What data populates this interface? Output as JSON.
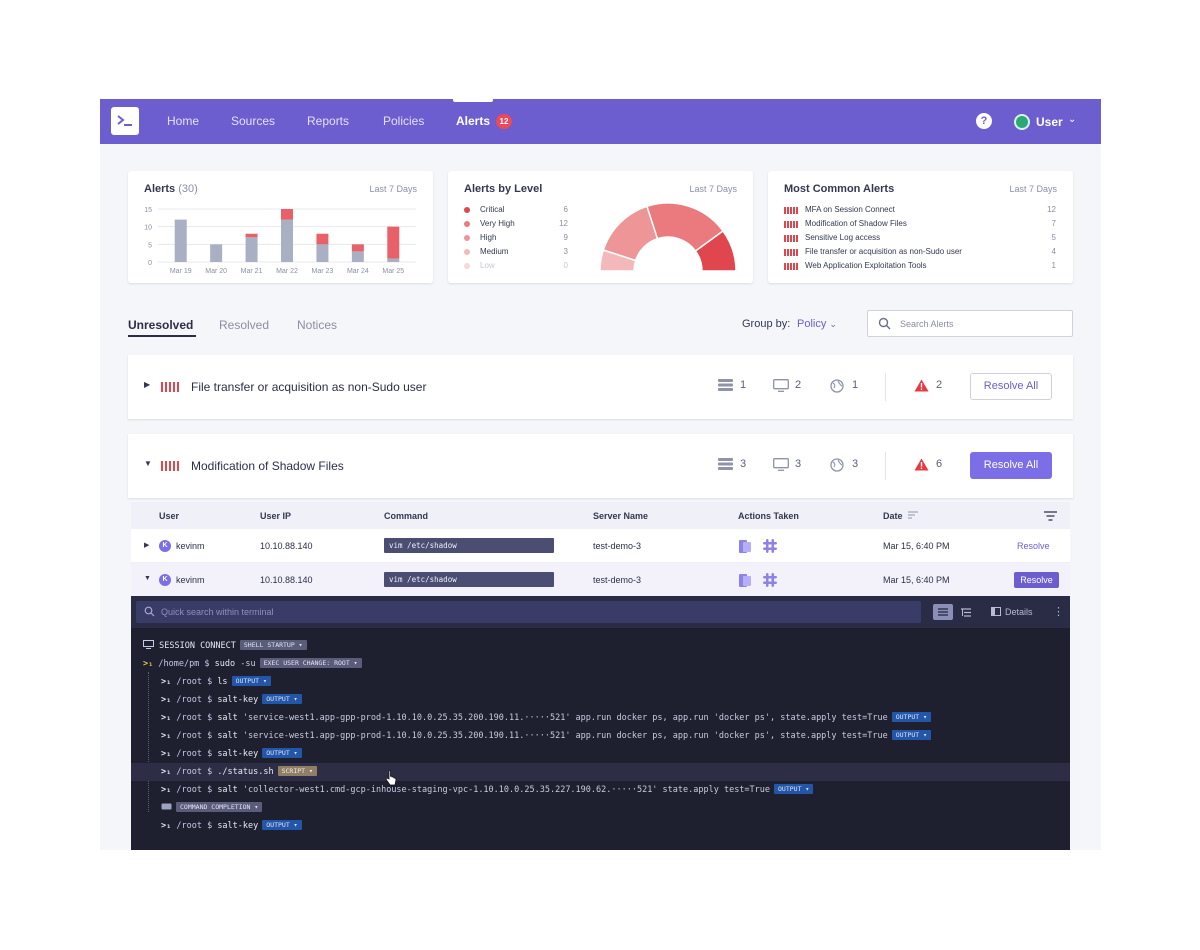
{
  "nav": {
    "items": [
      "Home",
      "Sources",
      "Reports",
      "Policies",
      "Alerts"
    ],
    "alerts_badge": "12",
    "help": "?",
    "user": "User"
  },
  "cards": {
    "alerts": {
      "title": "Alerts",
      "count": "(30)",
      "period": "Last 7 Days"
    },
    "by_level": {
      "title": "Alerts by Level",
      "period": "Last 7 Days",
      "levels": [
        {
          "name": "Critical",
          "value": "6",
          "color": "#e0464e"
        },
        {
          "name": "Very High",
          "value": "12",
          "color": "#ea7a7e"
        },
        {
          "name": "High",
          "value": "9",
          "color": "#ee9598"
        },
        {
          "name": "Medium",
          "value": "3",
          "color": "#f3b8ba"
        },
        {
          "name": "Low",
          "value": "0",
          "color": "#f6d9da"
        }
      ]
    },
    "common": {
      "title": "Most Common Alerts",
      "period": "Last 7 Days",
      "items": [
        {
          "name": "MFA on Session Connect",
          "count": "12"
        },
        {
          "name": "Modification of Shadow Files",
          "count": "7"
        },
        {
          "name": "Sensitive Log access",
          "count": "5"
        },
        {
          "name": "File transfer or acquisition as non-Sudo user",
          "count": "4"
        },
        {
          "name": "Web Application Exploitation Tools",
          "count": "1"
        }
      ]
    }
  },
  "chart_data": [
    {
      "type": "bar",
      "title": "Alerts (30)",
      "categories": [
        "Mar 19",
        "Mar 20",
        "Mar 21",
        "Mar 22",
        "Mar 23",
        "Mar 24",
        "Mar 25"
      ],
      "series": [
        {
          "name": "",
          "color": "#a9b0c3",
          "values": [
            12,
            5,
            7,
            12,
            5,
            3,
            1
          ]
        },
        {
          "name": "",
          "color": "#e86068",
          "values": [
            0,
            0,
            1,
            3,
            3,
            2,
            9
          ]
        }
      ],
      "yticks": [
        0,
        5,
        10,
        15
      ],
      "ylim": [
        0,
        15
      ],
      "stacked": true
    },
    {
      "type": "pie",
      "title": "Alerts by Level",
      "style": "half-donut",
      "labels": [
        "Critical",
        "Very High",
        "High",
        "Medium",
        "Low"
      ],
      "values": [
        6,
        12,
        9,
        3,
        0
      ]
    }
  ],
  "tabs": [
    "Unresolved",
    "Resolved",
    "Notices"
  ],
  "group_by": {
    "label": "Group by:",
    "value": "Policy"
  },
  "search": {
    "placeholder": "Search Alerts"
  },
  "policies": [
    {
      "name": "File transfer or acquisition as non-Sudo user",
      "sources": "1",
      "servers": "2",
      "ips": "1",
      "alerts": "2",
      "action": "Resolve All",
      "expanded": false
    },
    {
      "name": "Modification of Shadow Files",
      "sources": "3",
      "servers": "3",
      "ips": "3",
      "alerts": "6",
      "action": "Resolve All",
      "expanded": true
    }
  ],
  "table": {
    "headers": [
      "User",
      "User IP",
      "Command",
      "Server Name",
      "Actions Taken",
      "Date"
    ],
    "rows": [
      {
        "avatar": "K",
        "user": "kevinm",
        "ip": "10.10.88.140",
        "command": "vim /etc/shadow",
        "server": "test-demo-3",
        "date": "Mar 15, 6:40 PM",
        "action": "Resolve"
      },
      {
        "avatar": "K",
        "user": "kevinm",
        "ip": "10.10.88.140",
        "command": "vim /etc/shadow",
        "server": "test-demo-3",
        "date": "Mar 15, 6:40 PM",
        "action": "Resolve"
      }
    ]
  },
  "terminal": {
    "search_placeholder": "Quick search within terminal",
    "details": "Details",
    "lines": [
      {
        "icon": "monitor",
        "cmd": "SESSION CONNECT",
        "tag": "SHELL STARTUP ▾",
        "tagcolor": "grey"
      },
      {
        "prompt": "/home/pm $",
        "cmd": "sudo",
        "args": " -su",
        "tag": "EXEC USER CHANGE: ROOT ▾",
        "tagcolor": "grey"
      },
      {
        "prompt": "/root $",
        "cmd": "ls",
        "tag": "OUTPUT ▾",
        "tagcolor": "blue"
      },
      {
        "prompt": "/root $",
        "cmd": "salt-key",
        "tag": "OUTPUT ▾",
        "tagcolor": "blue"
      },
      {
        "prompt": "/root $",
        "cmd": "salt",
        "args": " 'service-west1.app-gpp-prod-1.10.10.0.25.35.200.190.11.·····521' app.run docker ps, app.run 'docker ps', state.apply test=True",
        "tag": "OUTPUT ▾",
        "tagcolor": "blue"
      },
      {
        "prompt": "/root $",
        "cmd": "salt",
        "args": " 'service-west1.app-gpp-prod-1.10.10.0.25.35.200.190.11.·····521' app.run docker ps, app.run 'docker ps', state.apply test=True",
        "tag": "OUTPUT ▾",
        "tagcolor": "blue"
      },
      {
        "prompt": "/root $",
        "cmd": "salt-key",
        "tag": "OUTPUT ▾",
        "tagcolor": "blue"
      },
      {
        "prompt": "/root $",
        "cmd": "./status.sh",
        "tag": "SCRIPT ▾",
        "tagcolor": "tan"
      },
      {
        "prompt": "/root $",
        "cmd": "salt",
        "args": " 'collector-west1.cmd-gcp-inhouse-staging-vpc-1.10.10.0.25.35.227.190.62.·····521' state.apply test=True",
        "tag": "OUTPUT ▾",
        "tagcolor": "blue"
      },
      {
        "icon": "keyboard",
        "tag": "COMMAND COMPLETION ▾",
        "tagcolor": "grey"
      },
      {
        "prompt": "/root $",
        "cmd": "salt-key",
        "tag": "OUTPUT ▾",
        "tagcolor": "blue"
      }
    ]
  }
}
